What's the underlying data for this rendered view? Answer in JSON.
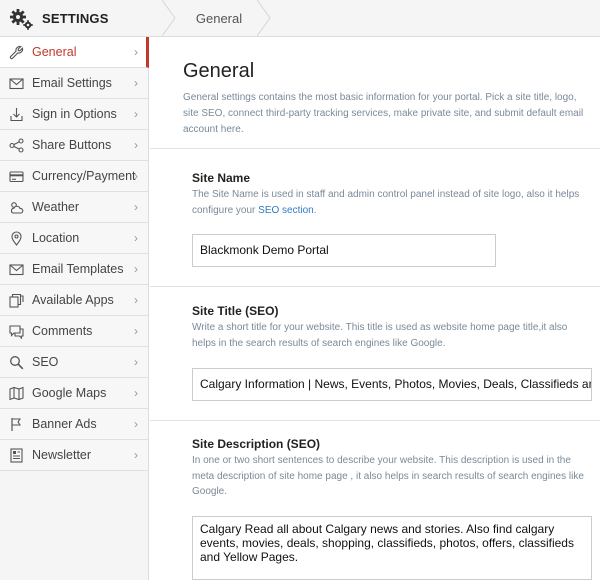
{
  "header": {
    "app_title": "SETTINGS",
    "breadcrumb": "General"
  },
  "sidebar": {
    "items": [
      {
        "label": "General",
        "icon": "wrench-icon",
        "active": true
      },
      {
        "label": "Email Settings",
        "icon": "envelope-icon"
      },
      {
        "label": "Sign in Options",
        "icon": "sign-in-icon"
      },
      {
        "label": "Share Buttons",
        "icon": "share-icon"
      },
      {
        "label": "Currency/Payment",
        "icon": "credit-card-icon"
      },
      {
        "label": "Weather",
        "icon": "cloud-sun-icon"
      },
      {
        "label": "Location",
        "icon": "map-pin-icon"
      },
      {
        "label": "Email Templates",
        "icon": "envelope-template-icon"
      },
      {
        "label": "Available Apps",
        "icon": "apps-icon"
      },
      {
        "label": "Comments",
        "icon": "comments-icon"
      },
      {
        "label": "SEO",
        "icon": "magnifier-icon"
      },
      {
        "label": "Google Maps",
        "icon": "map-icon"
      },
      {
        "label": "Banner Ads",
        "icon": "flag-icon"
      },
      {
        "label": "Newsletter",
        "icon": "newsletter-icon"
      }
    ],
    "chevron": "›"
  },
  "main": {
    "title": "General",
    "description": "General settings contains the most basic information for your portal. Pick a site title, logo, site SEO, connect third-party tracking services, make private site, and submit default email account here.",
    "site_name": {
      "label": "Site Name",
      "help_before": "The Site Name is used in staff and admin control panel instead of site logo, also it helps configure your ",
      "help_link": "SEO section",
      "help_after": ".",
      "value": "Blackmonk Demo Portal"
    },
    "site_title": {
      "label": "Site Title (SEO)",
      "help": "Write a short title for your website. This title is used as website home page title,it also helps in the search results of search engines like Google.",
      "value": "Calgary Information | News, Events, Photos, Movies, Deals, Classifieds and Yellow Pages"
    },
    "site_description": {
      "label": "Site Description (SEO)",
      "help": "In one or two short sentences to describe your website. This description is used in the meta description of site home page , it also helps in search results of search engines like Google.",
      "value": "Calgary Read all about Calgary news and stories. Also find calgary events, movies, deals, shopping, classifieds, photos, offers, classifieds and Yellow Pages."
    }
  },
  "colors": {
    "accent": "#c0392b",
    "link": "#2f7bbf",
    "help_text": "#7a8a99",
    "sidebar_bg": "#f5f5f5"
  }
}
